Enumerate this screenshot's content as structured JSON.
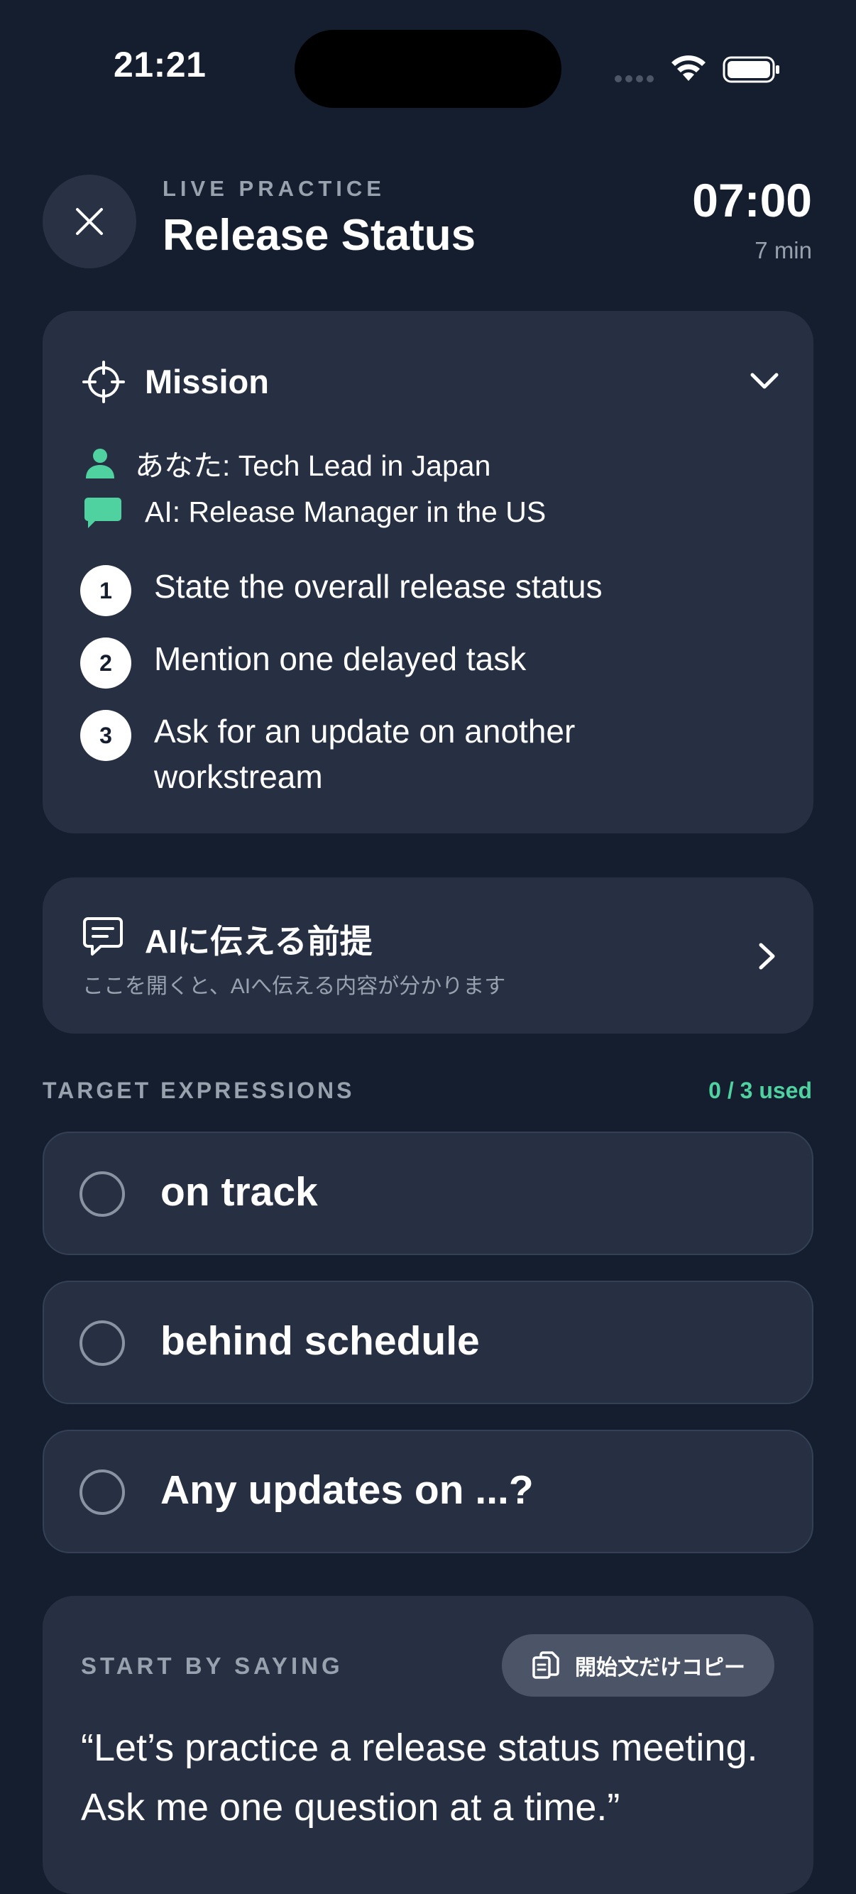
{
  "status_bar": {
    "time": "21:21"
  },
  "header": {
    "eyebrow": "LIVE PRACTICE",
    "title": "Release Status",
    "timer": "07:00",
    "duration": "7 min"
  },
  "mission": {
    "title": "Mission",
    "you_role": "あなた: Tech Lead in Japan",
    "ai_role": "AI: Release Manager in the US",
    "steps": [
      {
        "num": "1",
        "text": "State the overall release status"
      },
      {
        "num": "2",
        "text": "Mention one delayed task"
      },
      {
        "num": "3",
        "text": "Ask for an update on another workstream"
      }
    ]
  },
  "premise": {
    "title": "AIに伝える前提",
    "subtitle": "ここを開くと、AIへ伝える内容が分かります"
  },
  "targets": {
    "label": "TARGET EXPRESSIONS",
    "used": "0 / 3 used",
    "items": [
      {
        "text": "on track"
      },
      {
        "text": "behind schedule"
      },
      {
        "text": "Any updates on ...?"
      }
    ]
  },
  "start": {
    "label": "START BY SAYING",
    "copy_label": "開始文だけコピー",
    "text": "“Let’s practice a release status meeting. Ask me one question at a time.”"
  },
  "colors": {
    "background": "#151e2e",
    "card": "#263042",
    "accent_green": "#4fd1a0"
  }
}
